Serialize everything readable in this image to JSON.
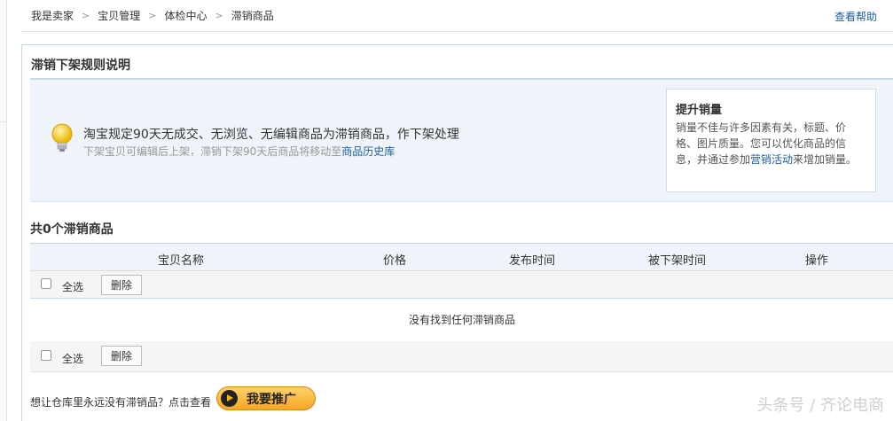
{
  "breadcrumb": [
    "我是卖家",
    "宝贝管理",
    "体检中心",
    "滞销商品"
  ],
  "breadcrumb_separator": ">",
  "help_link": "查看帮助",
  "panel_title": "滞销下架规则说明",
  "rule": {
    "main": "淘宝规定90天无成交、无浏览、无编辑商品为滞销商品，作下架处理",
    "sub_prefix": "下架宝贝可编辑后上架，滞销下架90天后商品将移动至",
    "sub_link": "商品历史库"
  },
  "tip_card": {
    "title": "提升销量",
    "body_prefix": "销量不佳与许多因素有关，标题、价格、图片质量。您可以优化商品的信息，并通过参加",
    "body_link": "营销活动",
    "body_suffix": "来增加销量。"
  },
  "count_title": "共0个滞销商品",
  "table": {
    "columns": [
      "宝贝名称",
      "价格",
      "发布时间",
      "被下架时间",
      "操作"
    ]
  },
  "select_all_label": "全选",
  "delete_button": "删除",
  "empty_message": "没有找到任何滞销商品",
  "footer_note": "想让仓库里永远没有滞销品？点击查看",
  "promo_button": "我要推广",
  "watermark": "头条号 / 齐论电商",
  "colors": {
    "accent_link": "#1a5e9a",
    "panel_border": "#c6d9e7",
    "info_bg": "#eef4fa",
    "promo_orange": "#f5a623"
  }
}
